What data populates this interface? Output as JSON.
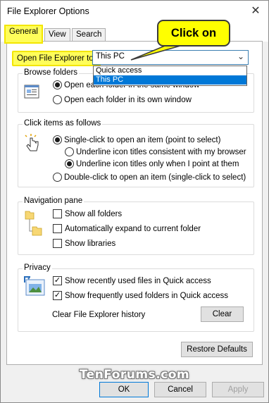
{
  "window": {
    "title": "File Explorer Options",
    "close_glyph": "✕"
  },
  "tabs": [
    {
      "label": "General",
      "active": true
    },
    {
      "label": "View",
      "active": false
    },
    {
      "label": "Search",
      "active": false
    }
  ],
  "highlight_color": "#fffd5a",
  "callout": {
    "text": "Click on"
  },
  "open_explorer": {
    "label": "Open File Explorer to:",
    "selected": "This PC",
    "options": [
      "Quick access",
      "This PC"
    ],
    "highlighted_option": "This PC"
  },
  "browse_folders": {
    "title": "Browse folders",
    "options": [
      {
        "label": "Open each folder in the same window",
        "selected": true
      },
      {
        "label": "Open each folder in its own window",
        "selected": false
      }
    ]
  },
  "click_items": {
    "title": "Click items as follows",
    "single_click": {
      "label": "Single-click to open an item (point to select)",
      "selected": true
    },
    "underline_browser": {
      "label": "Underline icon titles consistent with my browser",
      "selected": false
    },
    "underline_point": {
      "label": "Underline icon titles only when I point at them",
      "selected": true
    },
    "double_click": {
      "label": "Double-click to open an item (single-click to select)",
      "selected": false
    }
  },
  "navigation_pane": {
    "title": "Navigation pane",
    "options": [
      {
        "label": "Show all folders",
        "checked": false
      },
      {
        "label": "Automatically expand to current folder",
        "checked": false
      },
      {
        "label": "Show libraries",
        "checked": false
      }
    ]
  },
  "privacy": {
    "title": "Privacy",
    "options": [
      {
        "label": "Show recently used files in Quick access",
        "checked": true
      },
      {
        "label": "Show frequently used folders in Quick access",
        "checked": true
      }
    ],
    "clear_history_label": "Clear File Explorer history",
    "clear_button": "Clear"
  },
  "restore_defaults": "Restore Defaults",
  "footer": {
    "ok": "OK",
    "cancel": "Cancel",
    "apply": "Apply"
  },
  "watermark": "TenForums.com",
  "colors": {
    "selection": "#0078d7",
    "callout": "#ffff00",
    "accent_border": "#0078d7"
  }
}
